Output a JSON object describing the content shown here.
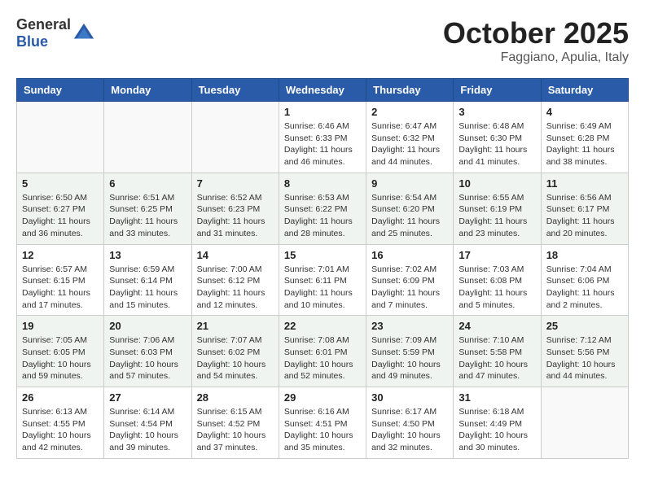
{
  "header": {
    "logo_general": "General",
    "logo_blue": "Blue",
    "month_title": "October 2025",
    "location": "Faggiano, Apulia, Italy"
  },
  "days_of_week": [
    "Sunday",
    "Monday",
    "Tuesday",
    "Wednesday",
    "Thursday",
    "Friday",
    "Saturday"
  ],
  "weeks": [
    {
      "days": [
        {
          "number": "",
          "info": ""
        },
        {
          "number": "",
          "info": ""
        },
        {
          "number": "",
          "info": ""
        },
        {
          "number": "1",
          "info": "Sunrise: 6:46 AM\nSunset: 6:33 PM\nDaylight: 11 hours and 46 minutes."
        },
        {
          "number": "2",
          "info": "Sunrise: 6:47 AM\nSunset: 6:32 PM\nDaylight: 11 hours and 44 minutes."
        },
        {
          "number": "3",
          "info": "Sunrise: 6:48 AM\nSunset: 6:30 PM\nDaylight: 11 hours and 41 minutes."
        },
        {
          "number": "4",
          "info": "Sunrise: 6:49 AM\nSunset: 6:28 PM\nDaylight: 11 hours and 38 minutes."
        }
      ]
    },
    {
      "days": [
        {
          "number": "5",
          "info": "Sunrise: 6:50 AM\nSunset: 6:27 PM\nDaylight: 11 hours and 36 minutes."
        },
        {
          "number": "6",
          "info": "Sunrise: 6:51 AM\nSunset: 6:25 PM\nDaylight: 11 hours and 33 minutes."
        },
        {
          "number": "7",
          "info": "Sunrise: 6:52 AM\nSunset: 6:23 PM\nDaylight: 11 hours and 31 minutes."
        },
        {
          "number": "8",
          "info": "Sunrise: 6:53 AM\nSunset: 6:22 PM\nDaylight: 11 hours and 28 minutes."
        },
        {
          "number": "9",
          "info": "Sunrise: 6:54 AM\nSunset: 6:20 PM\nDaylight: 11 hours and 25 minutes."
        },
        {
          "number": "10",
          "info": "Sunrise: 6:55 AM\nSunset: 6:19 PM\nDaylight: 11 hours and 23 minutes."
        },
        {
          "number": "11",
          "info": "Sunrise: 6:56 AM\nSunset: 6:17 PM\nDaylight: 11 hours and 20 minutes."
        }
      ]
    },
    {
      "days": [
        {
          "number": "12",
          "info": "Sunrise: 6:57 AM\nSunset: 6:15 PM\nDaylight: 11 hours and 17 minutes."
        },
        {
          "number": "13",
          "info": "Sunrise: 6:59 AM\nSunset: 6:14 PM\nDaylight: 11 hours and 15 minutes."
        },
        {
          "number": "14",
          "info": "Sunrise: 7:00 AM\nSunset: 6:12 PM\nDaylight: 11 hours and 12 minutes."
        },
        {
          "number": "15",
          "info": "Sunrise: 7:01 AM\nSunset: 6:11 PM\nDaylight: 11 hours and 10 minutes."
        },
        {
          "number": "16",
          "info": "Sunrise: 7:02 AM\nSunset: 6:09 PM\nDaylight: 11 hours and 7 minutes."
        },
        {
          "number": "17",
          "info": "Sunrise: 7:03 AM\nSunset: 6:08 PM\nDaylight: 11 hours and 5 minutes."
        },
        {
          "number": "18",
          "info": "Sunrise: 7:04 AM\nSunset: 6:06 PM\nDaylight: 11 hours and 2 minutes."
        }
      ]
    },
    {
      "days": [
        {
          "number": "19",
          "info": "Sunrise: 7:05 AM\nSunset: 6:05 PM\nDaylight: 10 hours and 59 minutes."
        },
        {
          "number": "20",
          "info": "Sunrise: 7:06 AM\nSunset: 6:03 PM\nDaylight: 10 hours and 57 minutes."
        },
        {
          "number": "21",
          "info": "Sunrise: 7:07 AM\nSunset: 6:02 PM\nDaylight: 10 hours and 54 minutes."
        },
        {
          "number": "22",
          "info": "Sunrise: 7:08 AM\nSunset: 6:01 PM\nDaylight: 10 hours and 52 minutes."
        },
        {
          "number": "23",
          "info": "Sunrise: 7:09 AM\nSunset: 5:59 PM\nDaylight: 10 hours and 49 minutes."
        },
        {
          "number": "24",
          "info": "Sunrise: 7:10 AM\nSunset: 5:58 PM\nDaylight: 10 hours and 47 minutes."
        },
        {
          "number": "25",
          "info": "Sunrise: 7:12 AM\nSunset: 5:56 PM\nDaylight: 10 hours and 44 minutes."
        }
      ]
    },
    {
      "days": [
        {
          "number": "26",
          "info": "Sunrise: 6:13 AM\nSunset: 4:55 PM\nDaylight: 10 hours and 42 minutes."
        },
        {
          "number": "27",
          "info": "Sunrise: 6:14 AM\nSunset: 4:54 PM\nDaylight: 10 hours and 39 minutes."
        },
        {
          "number": "28",
          "info": "Sunrise: 6:15 AM\nSunset: 4:52 PM\nDaylight: 10 hours and 37 minutes."
        },
        {
          "number": "29",
          "info": "Sunrise: 6:16 AM\nSunset: 4:51 PM\nDaylight: 10 hours and 35 minutes."
        },
        {
          "number": "30",
          "info": "Sunrise: 6:17 AM\nSunset: 4:50 PM\nDaylight: 10 hours and 32 minutes."
        },
        {
          "number": "31",
          "info": "Sunrise: 6:18 AM\nSunset: 4:49 PM\nDaylight: 10 hours and 30 minutes."
        },
        {
          "number": "",
          "info": ""
        }
      ]
    }
  ]
}
